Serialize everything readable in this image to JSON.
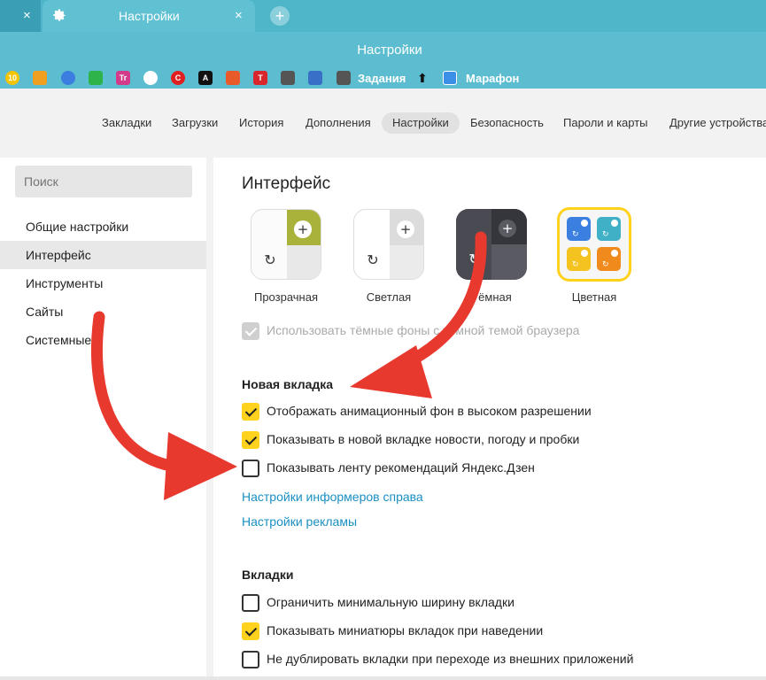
{
  "window": {
    "title": "Настройки"
  },
  "tabs": [
    {
      "label": "",
      "close": "×"
    },
    {
      "label": "Настройки",
      "close": "×"
    }
  ],
  "new_tab": "+",
  "bookmarks": [
    {
      "text": "10",
      "color": "#f5c400"
    },
    {
      "text": "",
      "color": "#f0a020"
    },
    {
      "text": "",
      "color": "#3b7de0"
    },
    {
      "text": "",
      "color": "#2db34a"
    },
    {
      "text": "Tr",
      "color": "#d33a8a"
    },
    {
      "text": "",
      "color": "#ffffff"
    },
    {
      "text": "C",
      "color": "#e02020"
    },
    {
      "text": "A",
      "color": "#111111"
    },
    {
      "text": "",
      "color": "#e85a2a"
    },
    {
      "text": "T",
      "color": "#d9262d"
    },
    {
      "text": "",
      "color": "#555555"
    },
    {
      "text": "",
      "color": "#3a6fc8"
    },
    {
      "text": "",
      "color": "#555555"
    }
  ],
  "bookmark_labels": {
    "tasks": "Задания",
    "marathon": "Марафон"
  },
  "nav": [
    "Закладки",
    "Загрузки",
    "История",
    "Дополнения",
    "Настройки",
    "Безопасность",
    "Пароли и карты",
    "Другие устройства"
  ],
  "nav_active": "Настройки",
  "search": {
    "placeholder": "Поиск"
  },
  "sidebar": [
    "Общие настройки",
    "Интерфейс",
    "Инструменты",
    "Сайты",
    "Системные"
  ],
  "sidebar_active": "Интерфейс",
  "section_title": "Интерфейс",
  "themes": [
    "Прозрачная",
    "Светлая",
    "Тёмная",
    "Цветная"
  ],
  "theme_selected": "Цветная",
  "dark_bg_option": {
    "label": "Использовать тёмные фоны с тёмной темой браузера",
    "checked": true,
    "disabled": true
  },
  "new_tab_section": {
    "title": "Новая вкладка",
    "options": [
      {
        "label": "Отображать анимационный фон в высоком разрешении",
        "checked": true
      },
      {
        "label": "Показывать в новой вкладке новости, погоду и пробки",
        "checked": true
      },
      {
        "label": "Показывать ленту рекомендаций Яндекс.Дзен",
        "checked": false
      }
    ],
    "links": [
      "Настройки информеров справа",
      "Настройки рекламы"
    ]
  },
  "tabs_section": {
    "title": "Вкладки",
    "options": [
      {
        "label": "Ограничить минимальную ширину вкладки",
        "checked": false
      },
      {
        "label": "Показывать миниатюры вкладок при наведении",
        "checked": true
      },
      {
        "label": "Не дублировать вкладки при переходе из внешних приложений",
        "checked": false
      }
    ]
  },
  "colors": {
    "accent": "#ffd21e",
    "header": "#5cbdd0",
    "link": "#1a8fc2",
    "arrow": "#e8392f"
  }
}
